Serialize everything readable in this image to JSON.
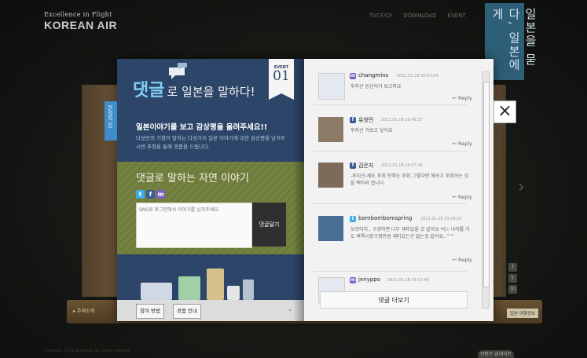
{
  "header": {
    "tagline": "Excellence in Flight",
    "brand": "KOREAN AIR",
    "nav": [
      "TVCF/CF",
      "DOWNLOAD",
      "EVENT"
    ],
    "banner_text": "일본을 묻다, 일본에게"
  },
  "book": {
    "event_badge_label": "EVENT",
    "event_badge_number": "01",
    "side_tab": "EVENT 02",
    "headline_big": "댓글",
    "headline_rest": "로 일본을 말하다!",
    "subhead": "일본이야기를 보고 감상평을 올려주세요!!",
    "description": "다섯번의 기항이 말하는 다섯가지 일본 이야기에 대한 감상평을 남겨주시면 추첨을 통해 경품을 드립니다.",
    "green_title": "댓글로 말하는 자연 이야기",
    "sns_icons": [
      "twitter-icon",
      "facebook-icon",
      "me2day-icon"
    ],
    "comment_placeholder": "SNS로 로그인해서 이야기를 남겨주세요.",
    "submit_label": "댓글달기",
    "bottom_tabs": [
      "참여 방법",
      "경품 안내"
    ]
  },
  "comments": {
    "items": [
      {
        "name": "changmins",
        "date": "2011.01.18 20:03:04",
        "text": "후지산 등산이가 보고파요",
        "badge": "me2day"
      },
      {
        "name": "유창민",
        "date": "2011.01.18 19:48:27",
        "text": "후지산 가보고 싶어요",
        "badge": "facebook"
      },
      {
        "name": "김은지",
        "date": "2011.01.18 19:37:26",
        "text": "-후지산-제도 후회 안해도 후회.그렇다면 해보고 후회하는 것을 택하라 합니다.",
        "badge": "facebook"
      },
      {
        "name": "bombombomspring",
        "date": "2011.01.18 19:29:20",
        "text": "보로미치.. 구경하면 너무 재미있을 것 같아요 어느 나라를 가도 벼룩시장구경만큼 재미있는건 없는것 같아요..^^",
        "badge": "twitter"
      },
      {
        "name": "jenyppo",
        "date": "2011.01.18 19:17:48",
        "text": "",
        "badge": "me2day"
      }
    ],
    "reply_label": "Reply",
    "more_label": "댓글 더보기"
  },
  "close_label": "×",
  "shelf": {
    "left_label": "▸ 주제소개",
    "right_label": "일본 여행정보"
  },
  "footer": {
    "text": "copyright 2011 koreanair all rights reserved",
    "button": "컨텐츠 업데이트"
  },
  "colors": {
    "page_blue": "#2d4569",
    "accent_blue": "#7fd0f4",
    "green": "#6e7c3a",
    "banner": "#2d5f78"
  }
}
